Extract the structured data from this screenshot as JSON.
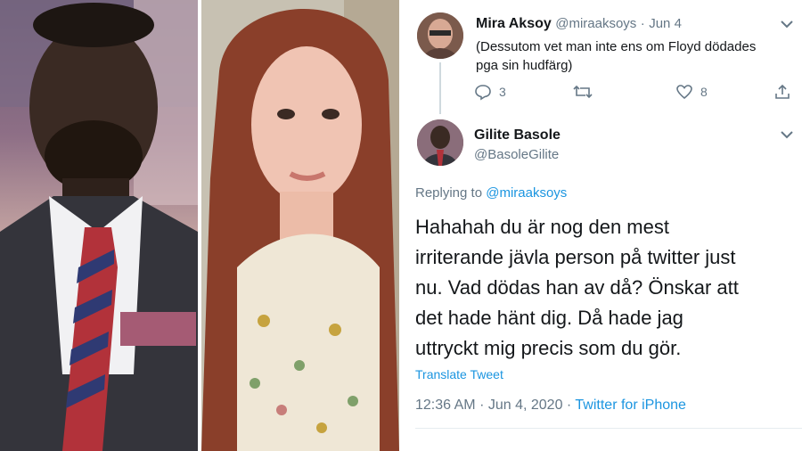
{
  "reply_context": {
    "author_name": "Mira Aksoy",
    "author_handle": "@miraaksoys",
    "date": "Jun 4",
    "text": "(Dessutom vet man inte ens om Floyd dödades\npga sin hudfärg)",
    "reply_count": "3",
    "like_count": "8"
  },
  "main_tweet": {
    "author_name": "Gilite Basole",
    "author_handle": "@BasoleGilite",
    "replying_prefix": "Replying to",
    "replying_to": "@miraaksoys",
    "text": "Hahahah du är nog den mest\nirriterande jävla person på twitter just\nnu. Vad dödas han av då? Önskar att\ndet hade hänt dig. Då hade jag\nuttryckt mig precis som du gör.",
    "translate_label": "Translate Tweet",
    "time": "12:36 AM",
    "separator": "·",
    "date": "Jun 4, 2020",
    "source": "Twitter for iPhone"
  },
  "colors": {
    "link": "#1b95e0",
    "muted": "#657786",
    "text": "#14171a"
  },
  "icons": [
    "chevron-down-icon",
    "reply-icon",
    "retweet-icon",
    "like-icon",
    "share-icon"
  ]
}
